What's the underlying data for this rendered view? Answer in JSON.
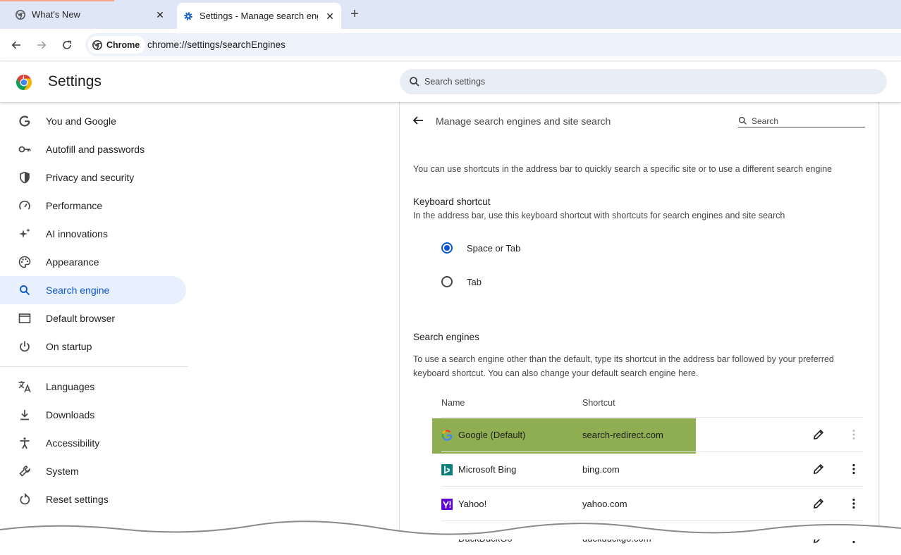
{
  "browser": {
    "tabs": [
      {
        "title": "What's New",
        "favicon": "chrome-icon"
      },
      {
        "title": "Settings - Manage search engines and site search",
        "favicon": "settings-gear-icon"
      }
    ],
    "chip_label": "Chrome",
    "url": "chrome://settings/searchEngines"
  },
  "header": {
    "title": "Settings",
    "search_placeholder": "Search settings"
  },
  "sidebar": {
    "items": [
      {
        "label": "You and Google",
        "icon": "google-g-icon"
      },
      {
        "label": "Autofill and passwords",
        "icon": "key-icon"
      },
      {
        "label": "Privacy and security",
        "icon": "shield-icon"
      },
      {
        "label": "Performance",
        "icon": "speedometer-icon"
      },
      {
        "label": "AI innovations",
        "icon": "sparkle-icon"
      },
      {
        "label": "Appearance",
        "icon": "palette-icon"
      },
      {
        "label": "Search engine",
        "icon": "search-icon",
        "active": true
      },
      {
        "label": "Default browser",
        "icon": "browser-window-icon"
      },
      {
        "label": "On startup",
        "icon": "power-icon"
      },
      {
        "label": "Languages",
        "icon": "translate-icon"
      },
      {
        "label": "Downloads",
        "icon": "download-icon"
      },
      {
        "label": "Accessibility",
        "icon": "accessibility-icon"
      },
      {
        "label": "System",
        "icon": "wrench-icon"
      },
      {
        "label": "Reset settings",
        "icon": "reset-icon"
      }
    ]
  },
  "panel": {
    "title": "Manage search engines and site search",
    "search_placeholder": "Search",
    "intro": "You can use shortcuts in the address bar to quickly search a specific site or to use a different search engine",
    "keyboard_heading": "Keyboard shortcut",
    "keyboard_desc": "In the address bar, use this keyboard shortcut with shortcuts for search engines and site search",
    "radio_options": [
      {
        "label": "Space or Tab",
        "selected": true
      },
      {
        "label": "Tab",
        "selected": false
      }
    ],
    "engines_heading": "Search engines",
    "engines_desc": "To use a search engine other than the default, type its shortcut in the address bar followed by your preferred keyboard shortcut. You can also change your default search engine here.",
    "columns": {
      "name": "Name",
      "shortcut": "Shortcut"
    },
    "engines": [
      {
        "name": "Google (Default)",
        "shortcut": "search-redirect.com",
        "highlighted": true
      },
      {
        "name": "Microsoft Bing",
        "shortcut": "bing.com"
      },
      {
        "name": "Yahoo!",
        "shortcut": "yahoo.com"
      },
      {
        "name": "DuckDuckGo",
        "shortcut": "duckduckgo.com"
      }
    ]
  },
  "colors": {
    "accent": "#0b57d0",
    "highlight": "#8fae51",
    "active_nav_bg": "#e8f0fe"
  }
}
